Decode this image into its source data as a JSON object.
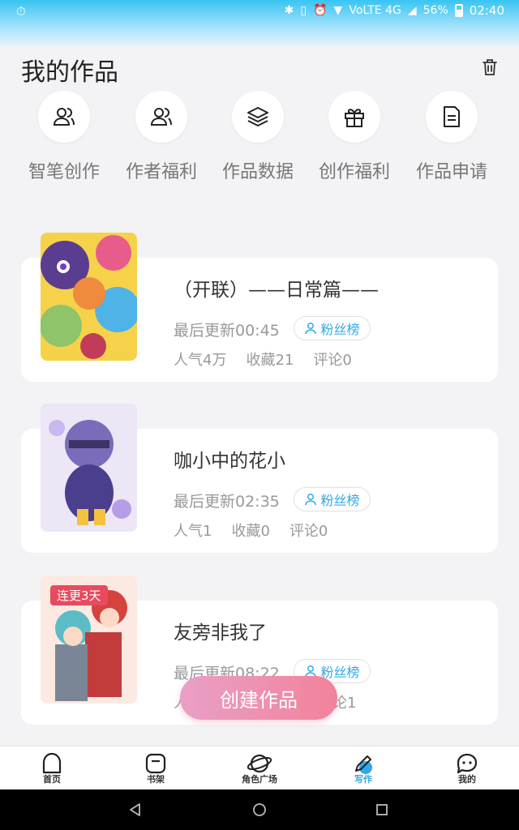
{
  "status_bar": {
    "left_icon": "timer-icon",
    "network": "VoLTE 4G",
    "battery": "56%",
    "time": "02:40"
  },
  "header": {
    "title": "我的作品",
    "trash_icon": "trash-icon"
  },
  "tools": [
    {
      "label": "智笔创作",
      "icon": "users-icon"
    },
    {
      "label": "作者福利",
      "icon": "users-icon"
    },
    {
      "label": "作品数据",
      "icon": "layers-icon"
    },
    {
      "label": "创作福利",
      "icon": "gift-icon"
    },
    {
      "label": "作品申请",
      "icon": "document-icon"
    }
  ],
  "works": [
    {
      "title": "（开联）——日常篇——",
      "update": "最后更新00:45",
      "fan_label": "粉丝榜",
      "popularity": "人气4万",
      "favorites": "收藏21",
      "comments": "评论0",
      "badge": ""
    },
    {
      "title": "咖小中的花小",
      "update": "最后更新02:35",
      "fan_label": "粉丝榜",
      "popularity": "人气1",
      "favorites": "收藏0",
      "comments": "评论0",
      "badge": ""
    },
    {
      "title": "友旁非我了",
      "update": "最后更新08:22",
      "fan_label": "粉丝榜",
      "popularity": "人",
      "favorites": "",
      "comments": "评论1",
      "badge": "连更3天"
    }
  ],
  "create_button": "创建作品",
  "bottom_nav": [
    {
      "label": "首页",
      "icon": "home-icon",
      "active": false
    },
    {
      "label": "书架",
      "icon": "bookshelf-icon",
      "active": false
    },
    {
      "label": "角色广场",
      "icon": "planet-icon",
      "active": false
    },
    {
      "label": "写作",
      "icon": "pen-icon",
      "active": true
    },
    {
      "label": "我的",
      "icon": "chat-icon",
      "active": false
    }
  ],
  "colors": {
    "accent": "#2fa9e8",
    "status_gradient_top": "#38c4f2",
    "create_button_start": "#e9a0c6",
    "create_button_end": "#f2829a",
    "badge": "#e84a5f"
  }
}
